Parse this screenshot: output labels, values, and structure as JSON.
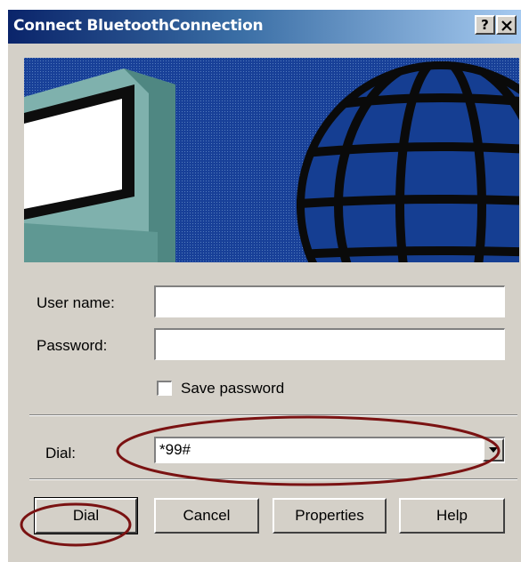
{
  "window": {
    "title": "Connect BluetoothConnection",
    "help_button": "?",
    "close_button": "✕"
  },
  "form": {
    "username_label": "User name:",
    "username_value": "",
    "password_label": "Password:",
    "password_value": "",
    "save_password_label": "Save password",
    "save_password_checked": false,
    "dial_label": "Dial:",
    "dial_value": "*99#"
  },
  "buttons": {
    "dial": "Dial",
    "cancel": "Cancel",
    "properties": "Properties",
    "help": "Help"
  },
  "banner": {
    "icons": [
      "computer-monitor-icon",
      "globe-icon"
    ]
  },
  "colors": {
    "titlebar_start": "#0a246a",
    "titlebar_end": "#a6caf0",
    "dialog_face": "#d4d0c8",
    "annotation": "#7a1212"
  }
}
